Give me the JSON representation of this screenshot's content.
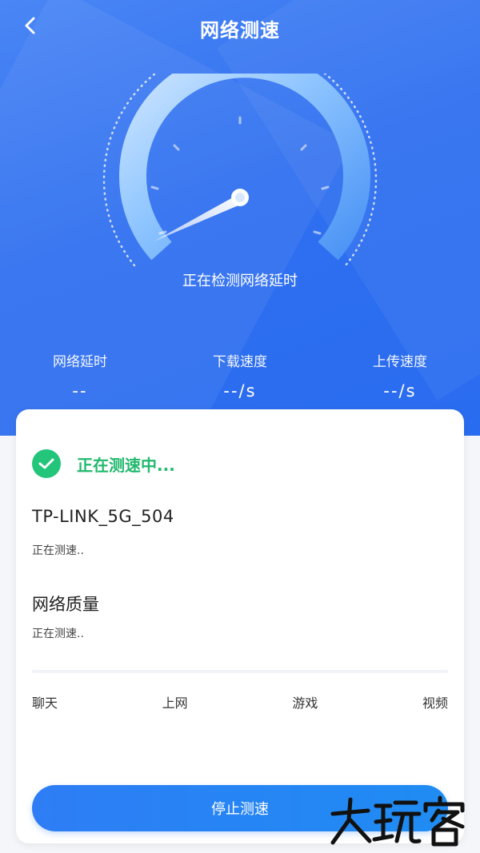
{
  "header": {
    "title": "网络测速",
    "back_icon": "chevron-left-icon"
  },
  "gauge": {
    "status": "正在检测网络延时"
  },
  "metrics": [
    {
      "label": "网络延时",
      "value": "--"
    },
    {
      "label": "下载速度",
      "value": "--/s"
    },
    {
      "label": "上传速度",
      "value": "--/s"
    }
  ],
  "card": {
    "status": "正在测速中...",
    "wifi_name": "TP-LINK_5G_504",
    "wifi_status": "正在测速..",
    "quality_title": "网络质量",
    "quality_status": "正在测速..",
    "quality_labels": [
      "聊天",
      "上网",
      "游戏",
      "视频"
    ],
    "stop_button": "停止测速"
  },
  "watermark": "大玩客",
  "colors": {
    "brand_blue": "#2f6ff0",
    "success_green": "#22c57a",
    "button_blue": "#2e7df5"
  }
}
